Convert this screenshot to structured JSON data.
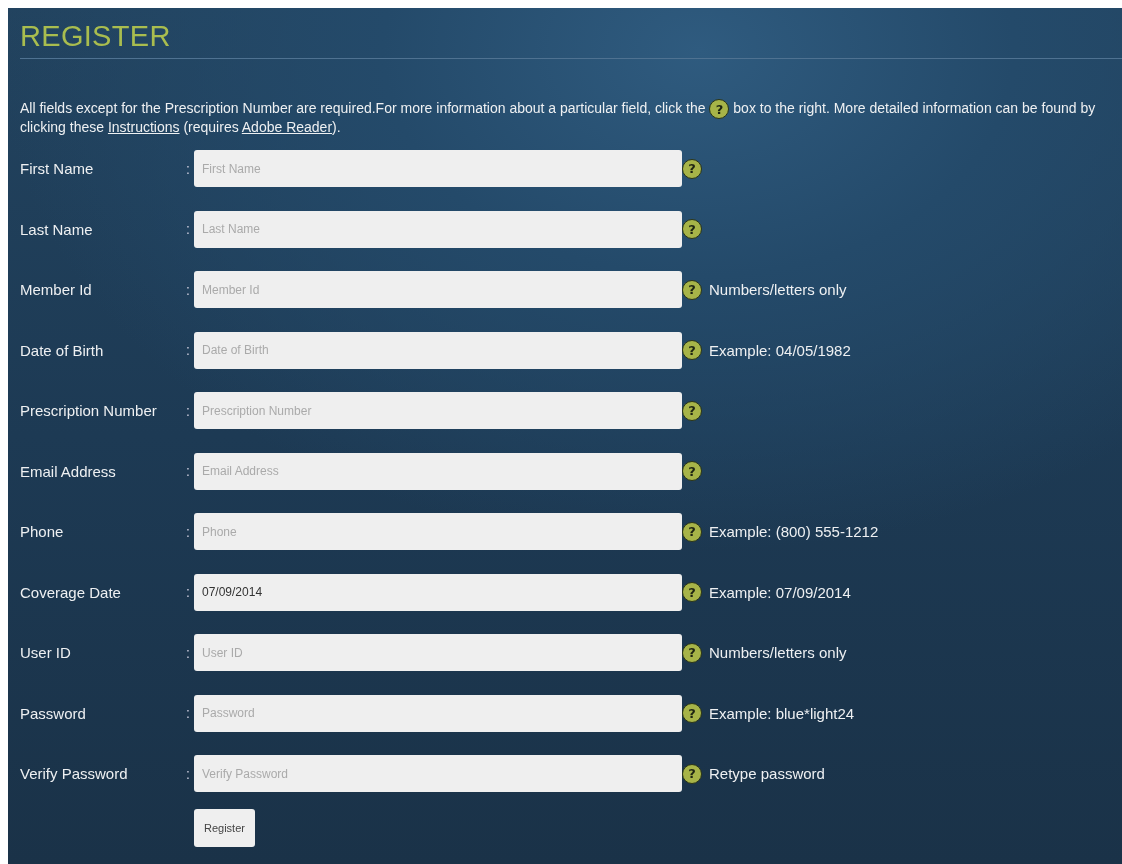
{
  "title": "REGISTER",
  "intro": [
    {
      "kind": "text",
      "text": "All fields except for the Prescription Number are required.For more information about a particular field, click the "
    },
    {
      "kind": "help",
      "text": "?"
    },
    {
      "kind": "text",
      "text": " box to the right. More detailed information can be found by clicking these "
    },
    {
      "kind": "link",
      "text": "Instructions"
    },
    {
      "kind": "text",
      "text": " (requires "
    },
    {
      "kind": "link",
      "text": "Adobe Reader"
    },
    {
      "kind": "text",
      "text": ")."
    }
  ],
  "fields": [
    {
      "label": "First Name",
      "colon": ":",
      "placeholder": "First Name",
      "help": "?"
    },
    {
      "label": "Last Name",
      "colon": ":",
      "placeholder": "Last Name",
      "help": "?"
    },
    {
      "label": "Member Id",
      "colon": ":",
      "placeholder": "Member Id",
      "help": "?",
      "hint": "Numbers/letters only"
    },
    {
      "label": "Date of Birth",
      "colon": ":",
      "placeholder": "Date of Birth",
      "help": "?",
      "hint": "Example: 04/05/1982"
    },
    {
      "label": "Prescription Number",
      "colon": ":",
      "placeholder": "Prescription Number",
      "help": "?"
    },
    {
      "label": "Email Address",
      "colon": ":",
      "placeholder": "Email Address",
      "help": "?"
    },
    {
      "label": "Phone",
      "colon": ":",
      "placeholder": "Phone",
      "help": "?",
      "hint": "Example: (800) 555-1212"
    },
    {
      "label": "Coverage Date",
      "colon": ":",
      "value": "07/09/2014",
      "help": "?",
      "hint": "Example: 07/09/2014"
    },
    {
      "label": "User ID",
      "colon": ":",
      "placeholder": "User ID",
      "help": "?",
      "hint": "Numbers/letters only"
    },
    {
      "label": "Password",
      "colon": ":",
      "placeholder": "Password",
      "help": "?",
      "hint": "Example: blue*light24"
    },
    {
      "label": "Verify Password",
      "colon": ":",
      "placeholder": "Verify Password",
      "help": "?",
      "hint": "Retype password"
    }
  ],
  "submit": "Register"
}
